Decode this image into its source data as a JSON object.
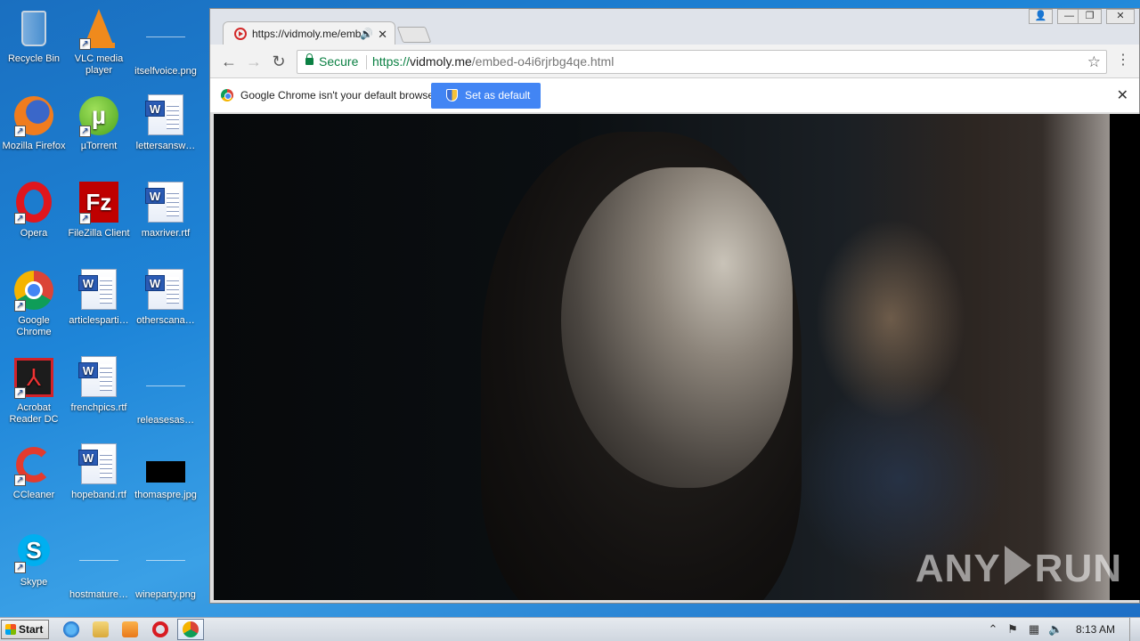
{
  "desktop": {
    "icons": [
      {
        "label": "Recycle Bin",
        "icon": "recycle-bin-icon"
      },
      {
        "label": "VLC media player",
        "icon": "vlc-icon"
      },
      {
        "label": "itselfvoice.png",
        "icon": "image-file-icon"
      },
      {
        "label": "Mozilla Firefox",
        "icon": "firefox-icon"
      },
      {
        "label": "µTorrent",
        "icon": "utorrent-icon"
      },
      {
        "label": "lettersansw…",
        "icon": "word-document-icon"
      },
      {
        "label": "Opera",
        "icon": "opera-icon"
      },
      {
        "label": "FileZilla Client",
        "icon": "filezilla-icon"
      },
      {
        "label": "maxriver.rtf",
        "icon": "word-document-icon"
      },
      {
        "label": "Google Chrome",
        "icon": "chrome-icon"
      },
      {
        "label": "articlesparti…",
        "icon": "word-document-icon"
      },
      {
        "label": "otherscana…",
        "icon": "word-document-icon"
      },
      {
        "label": "Acrobat Reader DC",
        "icon": "acrobat-icon"
      },
      {
        "label": "frenchpics.rtf",
        "icon": "word-document-icon"
      },
      {
        "label": "releasesas…",
        "icon": "image-file-icon"
      },
      {
        "label": "CCleaner",
        "icon": "ccleaner-icon"
      },
      {
        "label": "hopeband.rtf",
        "icon": "word-document-icon"
      },
      {
        "label": "thomaspre.jpg",
        "icon": "image-file-icon"
      },
      {
        "label": "Skype",
        "icon": "skype-icon"
      },
      {
        "label": "hostmature…",
        "icon": "image-file-icon"
      },
      {
        "label": "wineparty.png",
        "icon": "image-file-icon"
      }
    ]
  },
  "browser": {
    "tab": {
      "title": "https://vidmoly.me/emb",
      "favicon": "vidmoly-icon",
      "audio_icon": "🔊",
      "close": "✕"
    },
    "window_controls": {
      "user": "👤",
      "minimize": "—",
      "restore": "❐",
      "close": "✕"
    },
    "toolbar": {
      "back": "←",
      "forward": "→",
      "reload": "↻",
      "star": "☆",
      "menu": "⋮"
    },
    "address": {
      "secure_label": "Secure",
      "scheme": "https://",
      "host": "vidmoly.me",
      "path": "/embed-o4i6rjrbg4qe.html"
    },
    "infobar": {
      "message": "Google Chrome isn't your default browser.",
      "button_label": "Set as default",
      "close": "✕"
    },
    "video": {
      "watermark_left": "ANY",
      "watermark_right": "RUN"
    }
  },
  "taskbar": {
    "start_label": "Start",
    "pinned": [
      "internet-explorer-icon",
      "windows-explorer-icon",
      "media-player-icon",
      "opera-icon",
      "chrome-icon"
    ],
    "tray": {
      "expand": "⌃",
      "clock": "8:13 AM"
    }
  },
  "colors": {
    "accent": "#4285f4",
    "secure_green": "#0b8043"
  }
}
